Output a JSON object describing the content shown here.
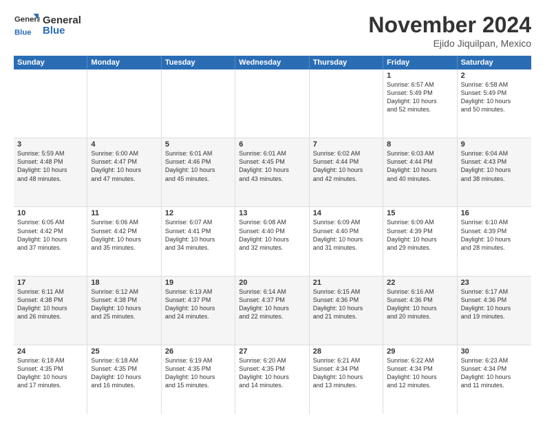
{
  "header": {
    "logo_general": "General",
    "logo_blue": "Blue",
    "month": "November 2024",
    "location": "Ejido Jiquilpan, Mexico"
  },
  "weekdays": [
    "Sunday",
    "Monday",
    "Tuesday",
    "Wednesday",
    "Thursday",
    "Friday",
    "Saturday"
  ],
  "weeks": [
    [
      {
        "day": "",
        "info": ""
      },
      {
        "day": "",
        "info": ""
      },
      {
        "day": "",
        "info": ""
      },
      {
        "day": "",
        "info": ""
      },
      {
        "day": "",
        "info": ""
      },
      {
        "day": "1",
        "info": "Sunrise: 6:57 AM\nSunset: 5:49 PM\nDaylight: 10 hours\nand 52 minutes."
      },
      {
        "day": "2",
        "info": "Sunrise: 6:58 AM\nSunset: 5:49 PM\nDaylight: 10 hours\nand 50 minutes."
      }
    ],
    [
      {
        "day": "3",
        "info": "Sunrise: 5:59 AM\nSunset: 4:48 PM\nDaylight: 10 hours\nand 48 minutes."
      },
      {
        "day": "4",
        "info": "Sunrise: 6:00 AM\nSunset: 4:47 PM\nDaylight: 10 hours\nand 47 minutes."
      },
      {
        "day": "5",
        "info": "Sunrise: 6:01 AM\nSunset: 4:46 PM\nDaylight: 10 hours\nand 45 minutes."
      },
      {
        "day": "6",
        "info": "Sunrise: 6:01 AM\nSunset: 4:45 PM\nDaylight: 10 hours\nand 43 minutes."
      },
      {
        "day": "7",
        "info": "Sunrise: 6:02 AM\nSunset: 4:44 PM\nDaylight: 10 hours\nand 42 minutes."
      },
      {
        "day": "8",
        "info": "Sunrise: 6:03 AM\nSunset: 4:44 PM\nDaylight: 10 hours\nand 40 minutes."
      },
      {
        "day": "9",
        "info": "Sunrise: 6:04 AM\nSunset: 4:43 PM\nDaylight: 10 hours\nand 38 minutes."
      }
    ],
    [
      {
        "day": "10",
        "info": "Sunrise: 6:05 AM\nSunset: 4:42 PM\nDaylight: 10 hours\nand 37 minutes."
      },
      {
        "day": "11",
        "info": "Sunrise: 6:06 AM\nSunset: 4:42 PM\nDaylight: 10 hours\nand 35 minutes."
      },
      {
        "day": "12",
        "info": "Sunrise: 6:07 AM\nSunset: 4:41 PM\nDaylight: 10 hours\nand 34 minutes."
      },
      {
        "day": "13",
        "info": "Sunrise: 6:08 AM\nSunset: 4:40 PM\nDaylight: 10 hours\nand 32 minutes."
      },
      {
        "day": "14",
        "info": "Sunrise: 6:09 AM\nSunset: 4:40 PM\nDaylight: 10 hours\nand 31 minutes."
      },
      {
        "day": "15",
        "info": "Sunrise: 6:09 AM\nSunset: 4:39 PM\nDaylight: 10 hours\nand 29 minutes."
      },
      {
        "day": "16",
        "info": "Sunrise: 6:10 AM\nSunset: 4:39 PM\nDaylight: 10 hours\nand 28 minutes."
      }
    ],
    [
      {
        "day": "17",
        "info": "Sunrise: 6:11 AM\nSunset: 4:38 PM\nDaylight: 10 hours\nand 26 minutes."
      },
      {
        "day": "18",
        "info": "Sunrise: 6:12 AM\nSunset: 4:38 PM\nDaylight: 10 hours\nand 25 minutes."
      },
      {
        "day": "19",
        "info": "Sunrise: 6:13 AM\nSunset: 4:37 PM\nDaylight: 10 hours\nand 24 minutes."
      },
      {
        "day": "20",
        "info": "Sunrise: 6:14 AM\nSunset: 4:37 PM\nDaylight: 10 hours\nand 22 minutes."
      },
      {
        "day": "21",
        "info": "Sunrise: 6:15 AM\nSunset: 4:36 PM\nDaylight: 10 hours\nand 21 minutes."
      },
      {
        "day": "22",
        "info": "Sunrise: 6:16 AM\nSunset: 4:36 PM\nDaylight: 10 hours\nand 20 minutes."
      },
      {
        "day": "23",
        "info": "Sunrise: 6:17 AM\nSunset: 4:36 PM\nDaylight: 10 hours\nand 19 minutes."
      }
    ],
    [
      {
        "day": "24",
        "info": "Sunrise: 6:18 AM\nSunset: 4:35 PM\nDaylight: 10 hours\nand 17 minutes."
      },
      {
        "day": "25",
        "info": "Sunrise: 6:18 AM\nSunset: 4:35 PM\nDaylight: 10 hours\nand 16 minutes."
      },
      {
        "day": "26",
        "info": "Sunrise: 6:19 AM\nSunset: 4:35 PM\nDaylight: 10 hours\nand 15 minutes."
      },
      {
        "day": "27",
        "info": "Sunrise: 6:20 AM\nSunset: 4:35 PM\nDaylight: 10 hours\nand 14 minutes."
      },
      {
        "day": "28",
        "info": "Sunrise: 6:21 AM\nSunset: 4:34 PM\nDaylight: 10 hours\nand 13 minutes."
      },
      {
        "day": "29",
        "info": "Sunrise: 6:22 AM\nSunset: 4:34 PM\nDaylight: 10 hours\nand 12 minutes."
      },
      {
        "day": "30",
        "info": "Sunrise: 6:23 AM\nSunset: 4:34 PM\nDaylight: 10 hours\nand 11 minutes."
      }
    ]
  ]
}
